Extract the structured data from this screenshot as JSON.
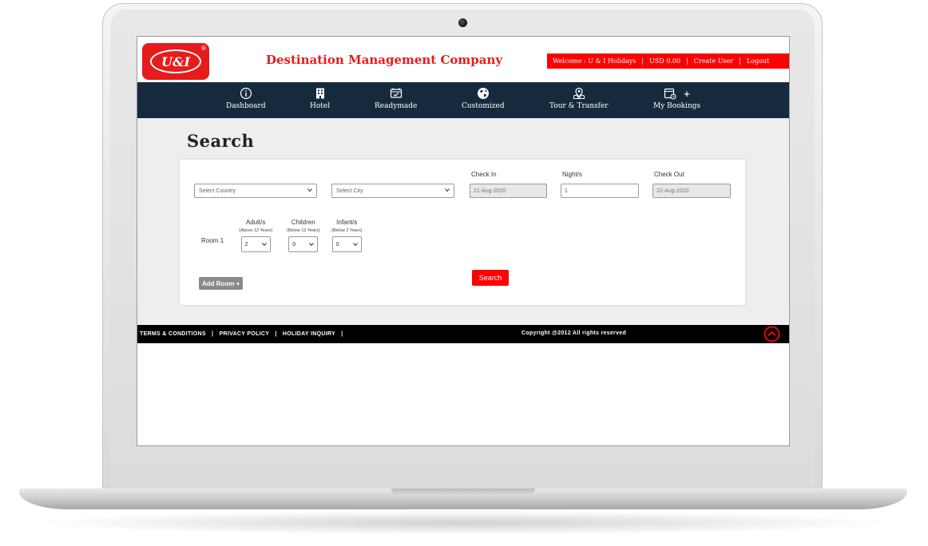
{
  "header": {
    "logo_text": "U&I",
    "logo_mark": "®",
    "company_title": "Destination Management Company",
    "topbar": {
      "welcome": "Welcome : U & I Holidays",
      "currency": "USD 0.00",
      "create_user": "Create User",
      "logout": "Logout",
      "separator": "|"
    }
  },
  "nav": {
    "items": [
      {
        "label": "Dashboard",
        "icon": "info-icon"
      },
      {
        "label": "Hotel",
        "icon": "building-icon"
      },
      {
        "label": "Readymade",
        "icon": "package-icon"
      },
      {
        "label": "Customized",
        "icon": "globe-icon"
      },
      {
        "label": "Tour & Transfer",
        "icon": "map-pin-icon"
      },
      {
        "label": "My Bookings",
        "icon": "calendar-icon",
        "suffix": "+"
      }
    ]
  },
  "search": {
    "title": "Search",
    "country_placeholder": "Select Country",
    "city_placeholder": "Select City",
    "check_in_label": "Check In",
    "check_in_value": "21-Aug-2020",
    "nights_label": "Night/s",
    "nights_value": "1",
    "check_out_label": "Check Out",
    "check_out_value": "22-Aug-2020",
    "room_label": "Room 1",
    "adults_label": "Adult/s",
    "adults_sub": "(Above 12 Years)",
    "adults_value": "2",
    "children_label": "Children",
    "children_sub": "(Below 12 Years)",
    "children_value": "0",
    "infants_label": "Infant/s",
    "infants_sub": "(Below 2 Years)",
    "infants_value": "0",
    "add_room_label": "Add Room +",
    "search_button": "Search"
  },
  "footer": {
    "terms": "TERMS & CONDITIONS",
    "privacy": "PRIVACY POLICY",
    "inquiry": "HOLIDAY INQUIRY",
    "separator": "|",
    "copyright": "Copyright @2012 All rights reserved"
  },
  "colors": {
    "brand_red": "#ff0000",
    "nav_bg": "#162a3e",
    "footer_bg": "#000000"
  }
}
